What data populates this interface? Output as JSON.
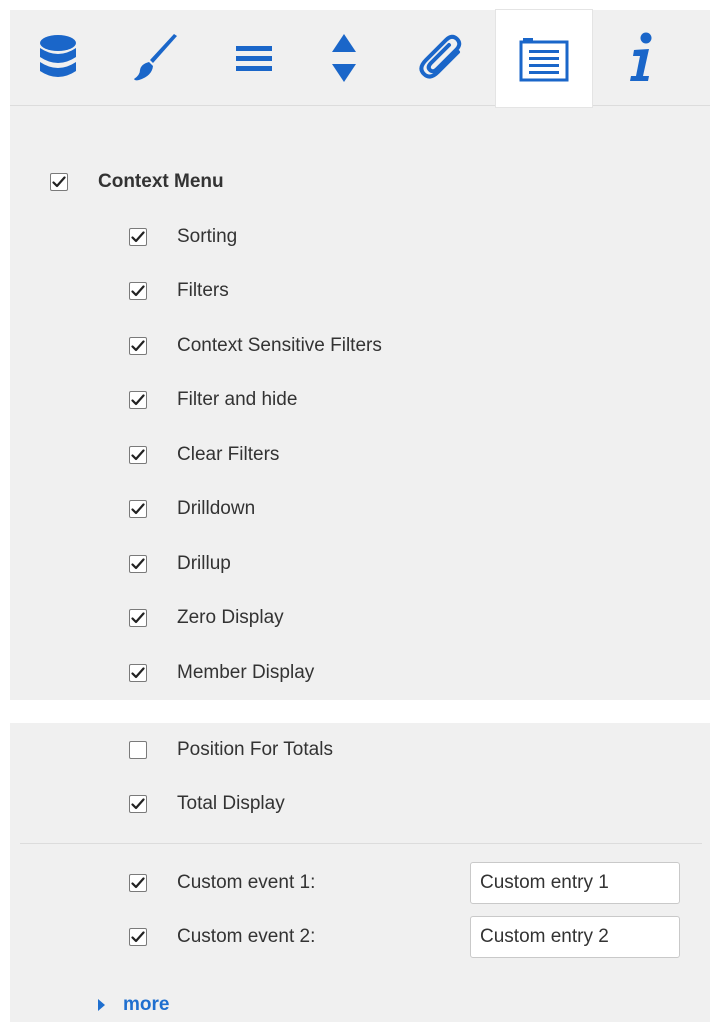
{
  "colors": {
    "accent": "#1a66c9",
    "panel_bg": "#f0f0f0",
    "text": "#333333",
    "link": "#1f6fcf"
  },
  "toolbar": {
    "tabs": [
      {
        "icon": "database-icon",
        "active": false
      },
      {
        "icon": "brush-icon",
        "active": false
      },
      {
        "icon": "menu-lines-icon",
        "active": false
      },
      {
        "icon": "sort-arrows-icon",
        "active": false
      },
      {
        "icon": "paperclip-icon",
        "active": false
      },
      {
        "icon": "list-icon",
        "active": true
      },
      {
        "icon": "info-icon",
        "active": false
      }
    ]
  },
  "context_menu": {
    "label": "Context Menu",
    "checked": true,
    "items": [
      {
        "label": "Sorting",
        "checked": true
      },
      {
        "label": "Filters",
        "checked": true
      },
      {
        "label": "Context Sensitive Filters",
        "checked": true
      },
      {
        "label": "Filter and hide",
        "checked": true
      },
      {
        "label": "Clear Filters",
        "checked": true
      },
      {
        "label": "Drilldown",
        "checked": true
      },
      {
        "label": "Drillup",
        "checked": true
      },
      {
        "label": "Zero Display",
        "checked": true
      },
      {
        "label": "Member Display",
        "checked": true
      },
      {
        "label": "Position For Totals",
        "checked": false
      },
      {
        "label": "Total Display",
        "checked": true
      }
    ]
  },
  "custom_events": [
    {
      "label": "Custom event 1:",
      "checked": true,
      "value": "Custom entry 1"
    },
    {
      "label": "Custom event 2:",
      "checked": true,
      "value": "Custom entry 2"
    }
  ],
  "more_label": "more"
}
